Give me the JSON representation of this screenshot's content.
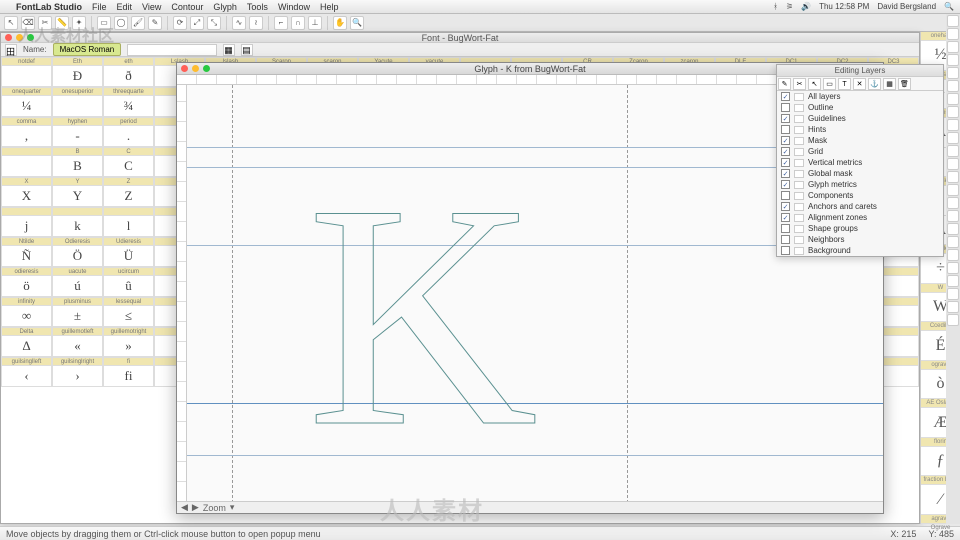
{
  "menubar": {
    "app": "FontLab Studio",
    "items": [
      "File",
      "Edit",
      "View",
      "Contour",
      "Glyph",
      "Tools",
      "Window",
      "Help"
    ],
    "right": {
      "time": "Thu 12:58 PM",
      "user": "David Bergsland"
    }
  },
  "watermark": "人人素材社区",
  "fontwin": {
    "title": "Font - BugWort-Fat",
    "encoding_label": "MacOS Roman",
    "name_label": "Name:"
  },
  "glyphwin": {
    "title": "Glyph - K from BugWort-Fat",
    "letter": "K",
    "zoom_label": "Zoom"
  },
  "layers": {
    "title": "Editing Layers",
    "items": [
      {
        "on": true,
        "name": "All layers"
      },
      {
        "on": false,
        "name": "Outline"
      },
      {
        "on": true,
        "name": "Guidelines"
      },
      {
        "on": false,
        "name": "Hints"
      },
      {
        "on": true,
        "name": "Mask"
      },
      {
        "on": true,
        "name": "Grid"
      },
      {
        "on": true,
        "name": "Vertical metrics"
      },
      {
        "on": true,
        "name": "Global mask"
      },
      {
        "on": true,
        "name": "Glyph metrics"
      },
      {
        "on": false,
        "name": "Components"
      },
      {
        "on": true,
        "name": "Anchors and carets"
      },
      {
        "on": true,
        "name": "Alignment zones"
      },
      {
        "on": false,
        "name": "Shape groups"
      },
      {
        "on": false,
        "name": "Neighbors"
      },
      {
        "on": false,
        "name": "Background"
      }
    ]
  },
  "grid_cells": [
    {
      "h": "notdef",
      "g": ""
    },
    {
      "h": "Eth",
      "g": "Ð"
    },
    {
      "h": "eth",
      "g": "ð"
    },
    {
      "h": "Lslash",
      "g": ""
    },
    {
      "h": "lslash",
      "g": ""
    },
    {
      "h": "Scaron",
      "g": ""
    },
    {
      "h": "scaron",
      "g": ""
    },
    {
      "h": "Yacute",
      "g": ""
    },
    {
      "h": "yacute",
      "g": ""
    },
    {
      "h": "",
      "g": ""
    },
    {
      "h": "",
      "g": ""
    },
    {
      "h": "CR",
      "g": ""
    },
    {
      "h": "Zcaron",
      "g": ""
    },
    {
      "h": "zcaron",
      "g": ""
    },
    {
      "h": "DLE",
      "g": ""
    },
    {
      "h": "DC1",
      "g": ""
    },
    {
      "h": "DC2",
      "g": ""
    },
    {
      "h": "DC3",
      "g": ""
    },
    {
      "h": "onequarter",
      "g": "¼"
    },
    {
      "h": "onesuperior",
      "g": ""
    },
    {
      "h": "threequarte",
      "g": "¾"
    },
    {
      "h": "",
      "g": ""
    },
    {
      "h": "",
      "g": ""
    },
    {
      "h": "",
      "g": ""
    },
    {
      "h": "",
      "g": ""
    },
    {
      "h": "",
      "g": ""
    },
    {
      "h": "",
      "g": ""
    },
    {
      "h": "",
      "g": ""
    },
    {
      "h": "",
      "g": ""
    },
    {
      "h": "",
      "g": ""
    },
    {
      "h": "",
      "g": ""
    },
    {
      "h": "",
      "g": ""
    },
    {
      "h": "",
      "g": ""
    },
    {
      "h": "",
      "g": ""
    },
    {
      "h": "",
      "g": ""
    },
    {
      "h": "",
      "g": ""
    },
    {
      "h": "comma",
      "g": ","
    },
    {
      "h": "hyphen",
      "g": "-"
    },
    {
      "h": "period",
      "g": "."
    },
    {
      "h": "",
      "g": ""
    },
    {
      "h": "",
      "g": ""
    },
    {
      "h": "",
      "g": ""
    },
    {
      "h": "",
      "g": ""
    },
    {
      "h": "",
      "g": ""
    },
    {
      "h": "",
      "g": ""
    },
    {
      "h": "",
      "g": ""
    },
    {
      "h": "",
      "g": ""
    },
    {
      "h": "",
      "g": ""
    },
    {
      "h": "",
      "g": ""
    },
    {
      "h": "",
      "g": ""
    },
    {
      "h": "",
      "g": ""
    },
    {
      "h": "",
      "g": ""
    },
    {
      "h": "",
      "g": ""
    },
    {
      "h": "",
      "g": ""
    },
    {
      "h": "",
      "g": ""
    },
    {
      "h": "B",
      "g": "B"
    },
    {
      "h": "C",
      "g": "C"
    },
    {
      "h": "",
      "g": ""
    },
    {
      "h": "",
      "g": ""
    },
    {
      "h": "",
      "g": ""
    },
    {
      "h": "",
      "g": ""
    },
    {
      "h": "",
      "g": ""
    },
    {
      "h": "",
      "g": ""
    },
    {
      "h": "",
      "g": ""
    },
    {
      "h": "",
      "g": ""
    },
    {
      "h": "",
      "g": ""
    },
    {
      "h": "",
      "g": ""
    },
    {
      "h": "",
      "g": ""
    },
    {
      "h": "",
      "g": ""
    },
    {
      "h": "",
      "g": ""
    },
    {
      "h": "",
      "g": ""
    },
    {
      "h": "",
      "g": ""
    },
    {
      "h": "X",
      "g": "X"
    },
    {
      "h": "Y",
      "g": "Y"
    },
    {
      "h": "Z",
      "g": "Z"
    },
    {
      "h": "",
      "g": ""
    },
    {
      "h": "",
      "g": ""
    },
    {
      "h": "",
      "g": ""
    },
    {
      "h": "",
      "g": ""
    },
    {
      "h": "",
      "g": ""
    },
    {
      "h": "",
      "g": ""
    },
    {
      "h": "",
      "g": ""
    },
    {
      "h": "",
      "g": ""
    },
    {
      "h": "",
      "g": ""
    },
    {
      "h": "",
      "g": ""
    },
    {
      "h": "",
      "g": ""
    },
    {
      "h": "",
      "g": ""
    },
    {
      "h": "",
      "g": ""
    },
    {
      "h": "",
      "g": ""
    },
    {
      "h": "",
      "g": ""
    },
    {
      "h": "",
      "g": "j"
    },
    {
      "h": "",
      "g": "k"
    },
    {
      "h": "",
      "g": "l"
    },
    {
      "h": "",
      "g": ""
    },
    {
      "h": "",
      "g": ""
    },
    {
      "h": "",
      "g": ""
    },
    {
      "h": "",
      "g": ""
    },
    {
      "h": "",
      "g": ""
    },
    {
      "h": "",
      "g": ""
    },
    {
      "h": "",
      "g": ""
    },
    {
      "h": "",
      "g": ""
    },
    {
      "h": "",
      "g": ""
    },
    {
      "h": "",
      "g": ""
    },
    {
      "h": "",
      "g": ""
    },
    {
      "h": "",
      "g": ""
    },
    {
      "h": "",
      "g": ""
    },
    {
      "h": "",
      "g": ""
    },
    {
      "h": "",
      "g": ""
    },
    {
      "h": "Ntilde",
      "g": "Ñ"
    },
    {
      "h": "Odieresis",
      "g": "Ö"
    },
    {
      "h": "Udieresis",
      "g": "Ü"
    },
    {
      "h": "",
      "g": ""
    },
    {
      "h": "",
      "g": ""
    },
    {
      "h": "",
      "g": ""
    },
    {
      "h": "",
      "g": ""
    },
    {
      "h": "",
      "g": ""
    },
    {
      "h": "",
      "g": ""
    },
    {
      "h": "",
      "g": ""
    },
    {
      "h": "",
      "g": ""
    },
    {
      "h": "",
      "g": ""
    },
    {
      "h": "",
      "g": ""
    },
    {
      "h": "",
      "g": ""
    },
    {
      "h": "",
      "g": ""
    },
    {
      "h": "",
      "g": ""
    },
    {
      "h": "",
      "g": ""
    },
    {
      "h": "",
      "g": ""
    },
    {
      "h": "odieresis",
      "g": "ö"
    },
    {
      "h": "uacute",
      "g": "ú"
    },
    {
      "h": "ucircum",
      "g": "û"
    },
    {
      "h": "",
      "g": ""
    },
    {
      "h": "",
      "g": ""
    },
    {
      "h": "",
      "g": ""
    },
    {
      "h": "",
      "g": ""
    },
    {
      "h": "",
      "g": ""
    },
    {
      "h": "",
      "g": ""
    },
    {
      "h": "",
      "g": ""
    },
    {
      "h": "",
      "g": ""
    },
    {
      "h": "",
      "g": ""
    },
    {
      "h": "",
      "g": ""
    },
    {
      "h": "",
      "g": ""
    },
    {
      "h": "",
      "g": ""
    },
    {
      "h": "",
      "g": ""
    },
    {
      "h": "",
      "g": ""
    },
    {
      "h": "",
      "g": ""
    },
    {
      "h": "infinity",
      "g": "∞"
    },
    {
      "h": "plusminus",
      "g": "±"
    },
    {
      "h": "lessequal",
      "g": "≤"
    },
    {
      "h": "",
      "g": ""
    },
    {
      "h": "",
      "g": ""
    },
    {
      "h": "",
      "g": ""
    },
    {
      "h": "",
      "g": ""
    },
    {
      "h": "",
      "g": ""
    },
    {
      "h": "",
      "g": ""
    },
    {
      "h": "",
      "g": ""
    },
    {
      "h": "",
      "g": ""
    },
    {
      "h": "",
      "g": ""
    },
    {
      "h": "",
      "g": ""
    },
    {
      "h": "",
      "g": ""
    },
    {
      "h": "",
      "g": ""
    },
    {
      "h": "",
      "g": ""
    },
    {
      "h": "",
      "g": ""
    },
    {
      "h": "",
      "g": ""
    },
    {
      "h": "Delta",
      "g": "Δ"
    },
    {
      "h": "guillemotleft",
      "g": "«"
    },
    {
      "h": "guillemotright",
      "g": "»"
    },
    {
      "h": "",
      "g": ""
    },
    {
      "h": "",
      "g": ""
    },
    {
      "h": "",
      "g": ""
    },
    {
      "h": "",
      "g": ""
    },
    {
      "h": "",
      "g": ""
    },
    {
      "h": "",
      "g": ""
    },
    {
      "h": "",
      "g": ""
    },
    {
      "h": "",
      "g": ""
    },
    {
      "h": "",
      "g": ""
    },
    {
      "h": "",
      "g": ""
    },
    {
      "h": "",
      "g": ""
    },
    {
      "h": "",
      "g": ""
    },
    {
      "h": "",
      "g": ""
    },
    {
      "h": "",
      "g": ""
    },
    {
      "h": "",
      "g": ""
    },
    {
      "h": "guilsinglleft",
      "g": "‹"
    },
    {
      "h": "guilsinglright",
      "g": "›"
    },
    {
      "h": "fi",
      "g": "fi"
    },
    {
      "h": "",
      "g": ""
    },
    {
      "h": "",
      "g": ""
    },
    {
      "h": "",
      "g": ""
    },
    {
      "h": "",
      "g": ""
    },
    {
      "h": "",
      "g": ""
    },
    {
      "h": "",
      "g": ""
    },
    {
      "h": "",
      "g": ""
    },
    {
      "h": "",
      "g": ""
    },
    {
      "h": "",
      "g": ""
    },
    {
      "h": "",
      "g": ""
    },
    {
      "h": "",
      "g": ""
    },
    {
      "h": "",
      "g": ""
    },
    {
      "h": "",
      "g": ""
    },
    {
      "h": "",
      "g": ""
    },
    {
      "h": "",
      "g": ""
    }
  ],
  "dock_cells": [
    {
      "h": "onehalf",
      "g": "½"
    },
    {
      "h": "plus",
      "g": "+"
    },
    {
      "h": "Adieresis",
      "g": "Ä"
    },
    {
      "h": "",
      "g": "?"
    },
    {
      "h": "acute",
      "g": "´"
    },
    {
      "h": "",
      "g": "A"
    },
    {
      "h": "divide",
      "g": "÷"
    },
    {
      "h": "W",
      "g": "W"
    },
    {
      "h": "",
      "g": ""
    },
    {
      "h": "Ccedilla    Eacute",
      "g": ""
    },
    {
      "h": "",
      "g": "É"
    },
    {
      "h": "ograve  ocircumflex",
      "g": ""
    },
    {
      "h": "",
      "g": "ò"
    },
    {
      "h": "AE   Oslash",
      "g": ""
    },
    {
      "h": "",
      "g": "Æ"
    },
    {
      "h": "florin  approxequal",
      "g": ""
    },
    {
      "h": "",
      "g": "ƒ"
    },
    {
      "h": "fraction   Euro",
      "g": ""
    },
    {
      "h": "",
      "g": "⁄"
    },
    {
      "h": "agrave   Ograve",
      "g": ""
    }
  ],
  "status": {
    "hint": "Move objects by dragging them or Ctrl-click mouse button to open popup menu",
    "x_label": "X:",
    "x_val": "215",
    "y_label": "Y:",
    "y_val": "485"
  },
  "logo_overlay": "人人素材"
}
